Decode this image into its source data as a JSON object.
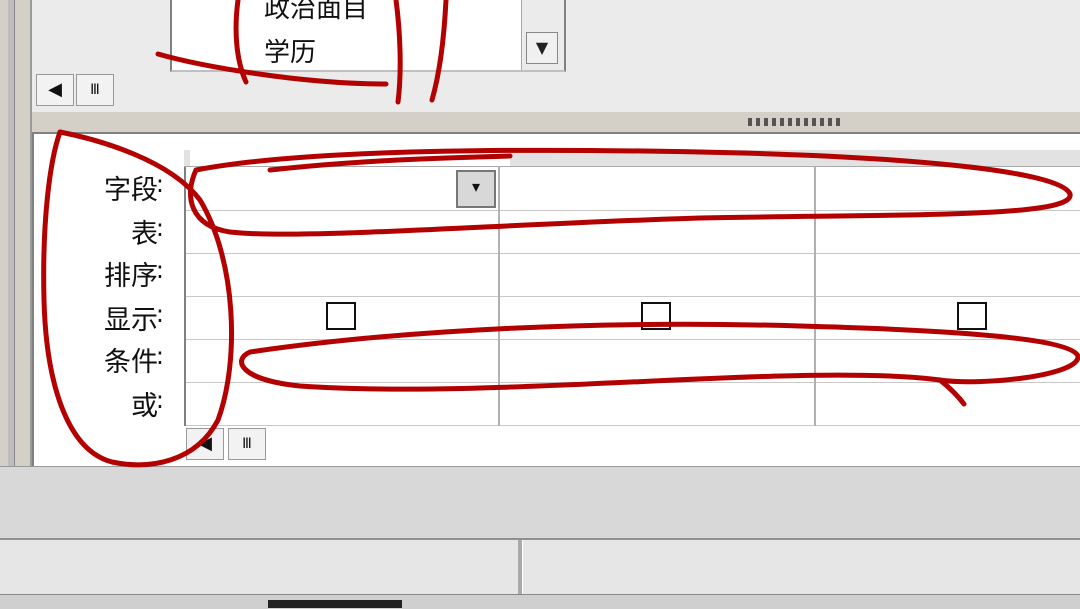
{
  "field_list": {
    "items": [
      "政治面目",
      "学历"
    ]
  },
  "scroll": {
    "left_arrow": "◀",
    "thumb": "Ⅲ",
    "down_arrow": "▼"
  },
  "design_grid": {
    "row_labels": [
      "字段",
      "表",
      "排序",
      "显示",
      "条件",
      "或"
    ],
    "colon": ":",
    "dropdown_arrow": "▾",
    "show_checked": [
      false,
      false,
      false
    ]
  },
  "colors": {
    "annotation": "#b30000",
    "panel_bg": "#d4d0c8",
    "grid_line": "#c8c8c8"
  },
  "icons": {
    "left_arrow": "scroll-left-icon",
    "thumb": "scroll-thumb-icon",
    "dropdown": "dropdown-arrow-icon"
  }
}
